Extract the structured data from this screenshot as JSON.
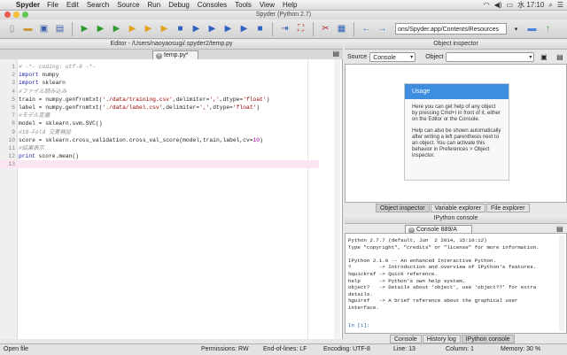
{
  "menubar": {
    "app": "Spyder",
    "items": [
      "File",
      "Edit",
      "Search",
      "Source",
      "Run",
      "Debug",
      "Consoles",
      "Tools",
      "View",
      "Help"
    ],
    "clock": "水 17:10"
  },
  "window": {
    "title": "Spyder (Python 2.7)"
  },
  "toolbar": {
    "path": "ons/Spyder.app/Contents/Resources"
  },
  "editor": {
    "header": "Editor - /Users/naoyaosugi/.spyder2/temp.py",
    "tab": "temp.py*",
    "lines": [
      {
        "n": "1",
        "parts": [
          {
            "c": "comment",
            "t": "# -*- coding: utf-8 -*-"
          }
        ]
      },
      {
        "n": "2",
        "parts": [
          {
            "c": "kw",
            "t": "import"
          },
          {
            "c": "",
            "t": " numpy"
          }
        ]
      },
      {
        "n": "3",
        "parts": [
          {
            "c": "kw",
            "t": "import"
          },
          {
            "c": "",
            "t": " sklearn"
          }
        ]
      },
      {
        "n": "4",
        "parts": [
          {
            "c": "comment",
            "t": "#ファイル読み込み"
          }
        ]
      },
      {
        "n": "5",
        "parts": [
          {
            "c": "",
            "t": "train = numpy.genfromtxt("
          },
          {
            "c": "str",
            "t": "'./data/training.csv'"
          },
          {
            "c": "",
            "t": ",delimiter="
          },
          {
            "c": "str",
            "t": "','"
          },
          {
            "c": "",
            "t": ",dtype="
          },
          {
            "c": "str",
            "t": "'float'"
          },
          {
            "c": "",
            "t": ")"
          }
        ]
      },
      {
        "n": "6",
        "parts": [
          {
            "c": "",
            "t": "label = numpy.genfromtxt("
          },
          {
            "c": "str",
            "t": "'./data/label.csv'"
          },
          {
            "c": "",
            "t": ",delimiter="
          },
          {
            "c": "str",
            "t": "','"
          },
          {
            "c": "",
            "t": ",dtype="
          },
          {
            "c": "str",
            "t": "'float'"
          },
          {
            "c": "",
            "t": ")"
          }
        ]
      },
      {
        "n": "7",
        "parts": [
          {
            "c": "comment",
            "t": "#モデル定義"
          }
        ]
      },
      {
        "n": "8",
        "parts": [
          {
            "c": "",
            "t": "model = sklearn.svm.SVC()"
          }
        ]
      },
      {
        "n": "9",
        "parts": [
          {
            "c": "comment",
            "t": "#10-Fold 交差検証"
          }
        ]
      },
      {
        "n": "10",
        "parts": [
          {
            "c": "",
            "t": "score = sklearn.cross_validation.cross_val_score(model,train,label,cv="
          },
          {
            "c": "num",
            "t": "10"
          },
          {
            "c": "",
            "t": ")"
          }
        ]
      },
      {
        "n": "11",
        "parts": [
          {
            "c": "comment",
            "t": "#結果表示"
          }
        ]
      },
      {
        "n": "12",
        "parts": [
          {
            "c": "kw",
            "t": "print"
          },
          {
            "c": "",
            "t": " score.mean()"
          }
        ]
      },
      {
        "n": "13",
        "parts": []
      }
    ]
  },
  "object_inspector": {
    "header": "Object inspector",
    "source_label": "Source",
    "source_value": "Console",
    "object_label": "Object",
    "usage_title": "Usage",
    "usage_p1": "Here you can get help of any object by pressing Cmd+I in front of it, either on the Editor or the Console.",
    "usage_p2": "Help can also be shown automatically after writing a left parenthesis next to an object. You can activate this behavior in Preferences > Object inspector.",
    "tabs": [
      "Object inspector",
      "Variable explorer",
      "File explorer"
    ]
  },
  "console": {
    "header": "IPython console",
    "tab": "Console 889/A",
    "output": "Python 2.7.7 (default, Jun  2 2014, 15:10:12)\nType \"copyright\", \"credits\" or \"license\" for more information.\n\nIPython 2.1.0 -- An enhanced Interactive Python.\n?         -> Introduction and overview of IPython's features.\n%quickref -> Quick reference.\nhelp      -> Python's own help system.\nobject?   -> Details about 'object', use 'object??' for extra\ndetails.\n%guiref   -> A brief reference about the graphical user\ninterface.\n",
    "prompt": "In [1]:",
    "tabs": [
      "Console",
      "History log",
      "IPython console"
    ]
  },
  "statusbar": {
    "left": "Open file",
    "permissions": "Permissions:  RW",
    "eol": "End-of-lines:  LF",
    "encoding": "Encoding:  UTF-8",
    "line": "Line:  13",
    "column": "Column:  1",
    "memory": "Memory:  30 %"
  }
}
